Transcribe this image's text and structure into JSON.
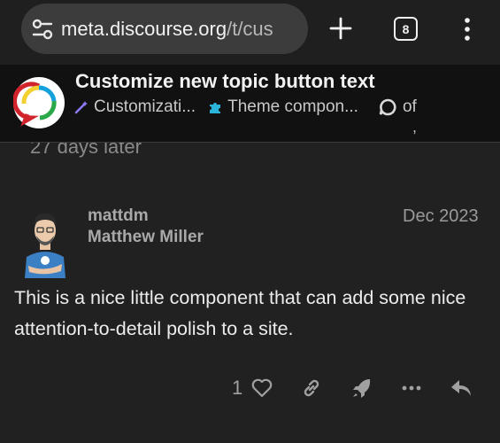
{
  "browser": {
    "url_host": "meta.discourse.org",
    "url_path": "/t/cus",
    "tab_count": "8",
    "icons": [
      "tune-icon",
      "plus-icon",
      "tab-switcher-icon",
      "more-vert-icon"
    ]
  },
  "topic": {
    "title": "Customize new topic button text",
    "breadcrumbs": [
      {
        "label": "Customizati...",
        "icon": "wand-icon",
        "color": "#8b7cf6"
      },
      {
        "label": "Theme compon...",
        "icon": "puzzle-icon",
        "color": "#2bb3d9"
      }
    ],
    "reply_count_label": "of",
    "stray_text": ","
  },
  "timeline": {
    "gap_label": "27 days later"
  },
  "post": {
    "username": "mattdm",
    "full_name": "Matthew Miller",
    "date": "Dec 2023",
    "body": "This is a nice little component that can add some nice attention-to-detail polish to a site.",
    "like_count": "1",
    "actions": [
      "heart-icon",
      "link-icon",
      "boost-rocket-icon",
      "more-horiz-icon",
      "reply-icon"
    ]
  },
  "colors": {
    "background": "#212121",
    "header_background": "#111111",
    "browser_bar": "#1f1f1f",
    "url_pill": "#3c3c3c"
  }
}
